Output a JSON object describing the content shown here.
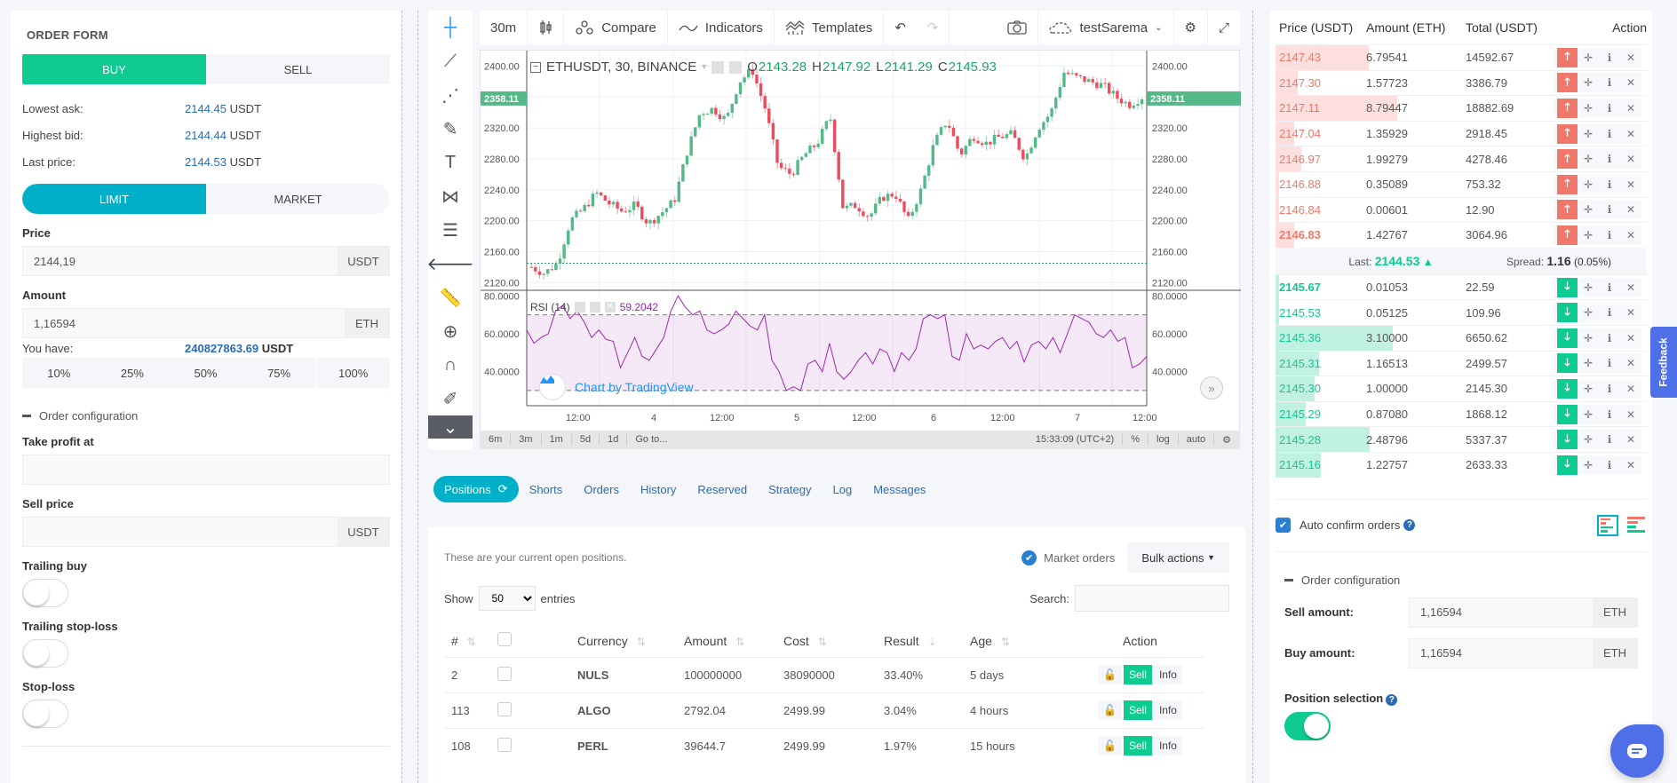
{
  "order_form": {
    "title": "ORDER FORM",
    "side_tabs": [
      "BUY",
      "SELL"
    ],
    "active_side": "BUY",
    "lowest_ask_label": "Lowest ask:",
    "lowest_ask_value": "2144.45",
    "highest_bid_label": "Highest bid:",
    "highest_bid_value": "2144.44",
    "last_price_label": "Last price:",
    "last_price_value": "2144.53",
    "quote_unit": "USDT",
    "type_tabs": [
      "LIMIT",
      "MARKET"
    ],
    "active_type": "LIMIT",
    "price_label": "Price",
    "price_value": "2144,19",
    "price_unit": "USDT",
    "amount_label": "Amount",
    "amount_value": "1,16594",
    "amount_unit": "ETH",
    "you_have_label": "You have:",
    "you_have_value": "240827863.69",
    "you_have_unit": "USDT",
    "percents": [
      "10%",
      "25%",
      "50%",
      "75%",
      "100%"
    ],
    "order_config_label": "Order configuration",
    "take_profit_label": "Take profit at",
    "take_profit_value": "",
    "sell_price_label": "Sell price",
    "sell_price_value": "",
    "sell_price_unit": "USDT",
    "trailing_buy_label": "Trailing buy",
    "trailing_buy_on": false,
    "trailing_stop_label": "Trailing stop-loss",
    "trailing_stop_on": false,
    "stop_loss_label": "Stop-loss",
    "stop_loss_on": false
  },
  "chart_toolbar": {
    "interval": "30m",
    "compare": "Compare",
    "indicators": "Indicators",
    "templates": "Templates",
    "account": "testSarema"
  },
  "chart": {
    "symbol": "ETHUSDT, 30, BINANCE",
    "o_label": "O",
    "o": "2143.28",
    "h_label": "H",
    "h": "2147.92",
    "l_label": "L",
    "l": "2141.29",
    "c_label": "C",
    "c": "2145.93",
    "price_ticks": [
      "2400.00",
      "2320.00",
      "2280.00",
      "2240.00",
      "2200.00",
      "2160.00",
      "2120.00"
    ],
    "current_price_tag": "2358.11",
    "rsi_label": "RSI (14)",
    "rsi_value": "59.2042",
    "rsi_ticks": [
      "80.0000",
      "60.0000",
      "40.0000"
    ],
    "time_ticks": [
      "12:00",
      "4",
      "12:00",
      "5",
      "12:00",
      "6",
      "12:00",
      "7",
      "12:00"
    ],
    "watermark": "Chart by TradingView",
    "ranges": [
      "6m",
      "3m",
      "1m",
      "5d",
      "1d",
      "Go to..."
    ],
    "clock": "15:33:09 (UTC+2)",
    "scale_opts": [
      "%",
      "log",
      "auto"
    ]
  },
  "tabs": [
    {
      "label": "Positions",
      "active": true
    },
    {
      "label": "Shorts"
    },
    {
      "label": "Orders"
    },
    {
      "label": "History"
    },
    {
      "label": "Reserved"
    },
    {
      "label": "Strategy"
    },
    {
      "label": "Log"
    },
    {
      "label": "Messages"
    }
  ],
  "positions": {
    "hint": "These are your current open positions.",
    "market_orders_label": "Market orders",
    "bulk_actions": "Bulk actions",
    "show_label": "Show",
    "show_value": "50",
    "entries_label": "entries",
    "search_label": "Search:",
    "search_value": "",
    "columns": [
      "#",
      "",
      "Currency",
      "Amount",
      "Cost",
      "Result",
      "Age",
      "Action"
    ],
    "rows": [
      {
        "id": "2",
        "currency": "NULS",
        "amount": "100000000",
        "cost": "38090000",
        "result": "33.40%",
        "age": "5 days"
      },
      {
        "id": "113",
        "currency": "ALGO",
        "amount": "2792.04",
        "cost": "2499.99",
        "result": "3.04%",
        "age": "4 hours"
      },
      {
        "id": "108",
        "currency": "PERL",
        "amount": "39644.7",
        "cost": "2499.99",
        "result": "1.97%",
        "age": "15 hours"
      }
    ],
    "sell_label": "Sell",
    "info_label": "Info"
  },
  "order_book": {
    "headers": [
      "Price (USDT)",
      "Amount (ETH)",
      "Total (USDT)",
      "Action"
    ],
    "asks": [
      {
        "price": "2147.43",
        "amount": "6.79541",
        "total": "14592.67",
        "depth": 0.77
      },
      {
        "price": "2147.30",
        "amount": "1.57723",
        "total": "3386.79",
        "depth": 0.18
      },
      {
        "price": "2147.11",
        "amount": "8.79447",
        "total": "18882.69",
        "depth": 1.0
      },
      {
        "price": "2147.04",
        "amount": "1.35929",
        "total": "2918.45",
        "depth": 0.15
      },
      {
        "price": "2146.97",
        "amount": "1.99279",
        "total": "4278.46",
        "depth": 0.21
      },
      {
        "price": "2146.88",
        "amount": "0.35089",
        "total": "753.32",
        "depth": 0.03
      },
      {
        "price": "2146.84",
        "amount": "0.00601",
        "total": "12.90",
        "depth": 0.03
      },
      {
        "price": "2146.83",
        "amount": "1.42767",
        "total": "3064.96",
        "depth": 0.15,
        "bold": true
      }
    ],
    "last_label": "Last:",
    "last_value": "2144.53",
    "spread_label": "Spread:",
    "spread_value": "1.16",
    "spread_pct": "(0.05%)",
    "bids": [
      {
        "price": "2145.67",
        "amount": "0.01053",
        "total": "22.59",
        "depth": 0.03,
        "bold": true
      },
      {
        "price": "2145.53",
        "amount": "0.05125",
        "total": "109.96",
        "depth": 0.03
      },
      {
        "price": "2145.36",
        "amount": "3.10000",
        "total": "6650.62",
        "depth": 1.0
      },
      {
        "price": "2145.31",
        "amount": "1.16513",
        "total": "2499.57",
        "depth": 0.37
      },
      {
        "price": "2145.30",
        "amount": "1.00000",
        "total": "2145.30",
        "depth": 0.33
      },
      {
        "price": "2145.29",
        "amount": "0.87080",
        "total": "1868.12",
        "depth": 0.26
      },
      {
        "price": "2145.28",
        "amount": "2.48796",
        "total": "5337.37",
        "depth": 0.8
      },
      {
        "price": "2145.16",
        "amount": "1.22757",
        "total": "2633.33",
        "depth": 0.39
      }
    ],
    "auto_confirm_label": "Auto confirm orders",
    "auto_confirm_on": true,
    "order_config_label": "Order configuration",
    "sell_amount_label": "Sell amount:",
    "sell_amount_value": "1,16594",
    "buy_amount_label": "Buy amount:",
    "buy_amount_value": "1,16594",
    "amount_unit": "ETH",
    "position_selection_label": "Position selection",
    "position_selection_on": true
  },
  "feedback_label": "Feedback",
  "colors": {
    "buy": "#0ecb92",
    "sell": "#f0786b",
    "accent": "#00b0c8",
    "link": "#2a6bb8"
  }
}
